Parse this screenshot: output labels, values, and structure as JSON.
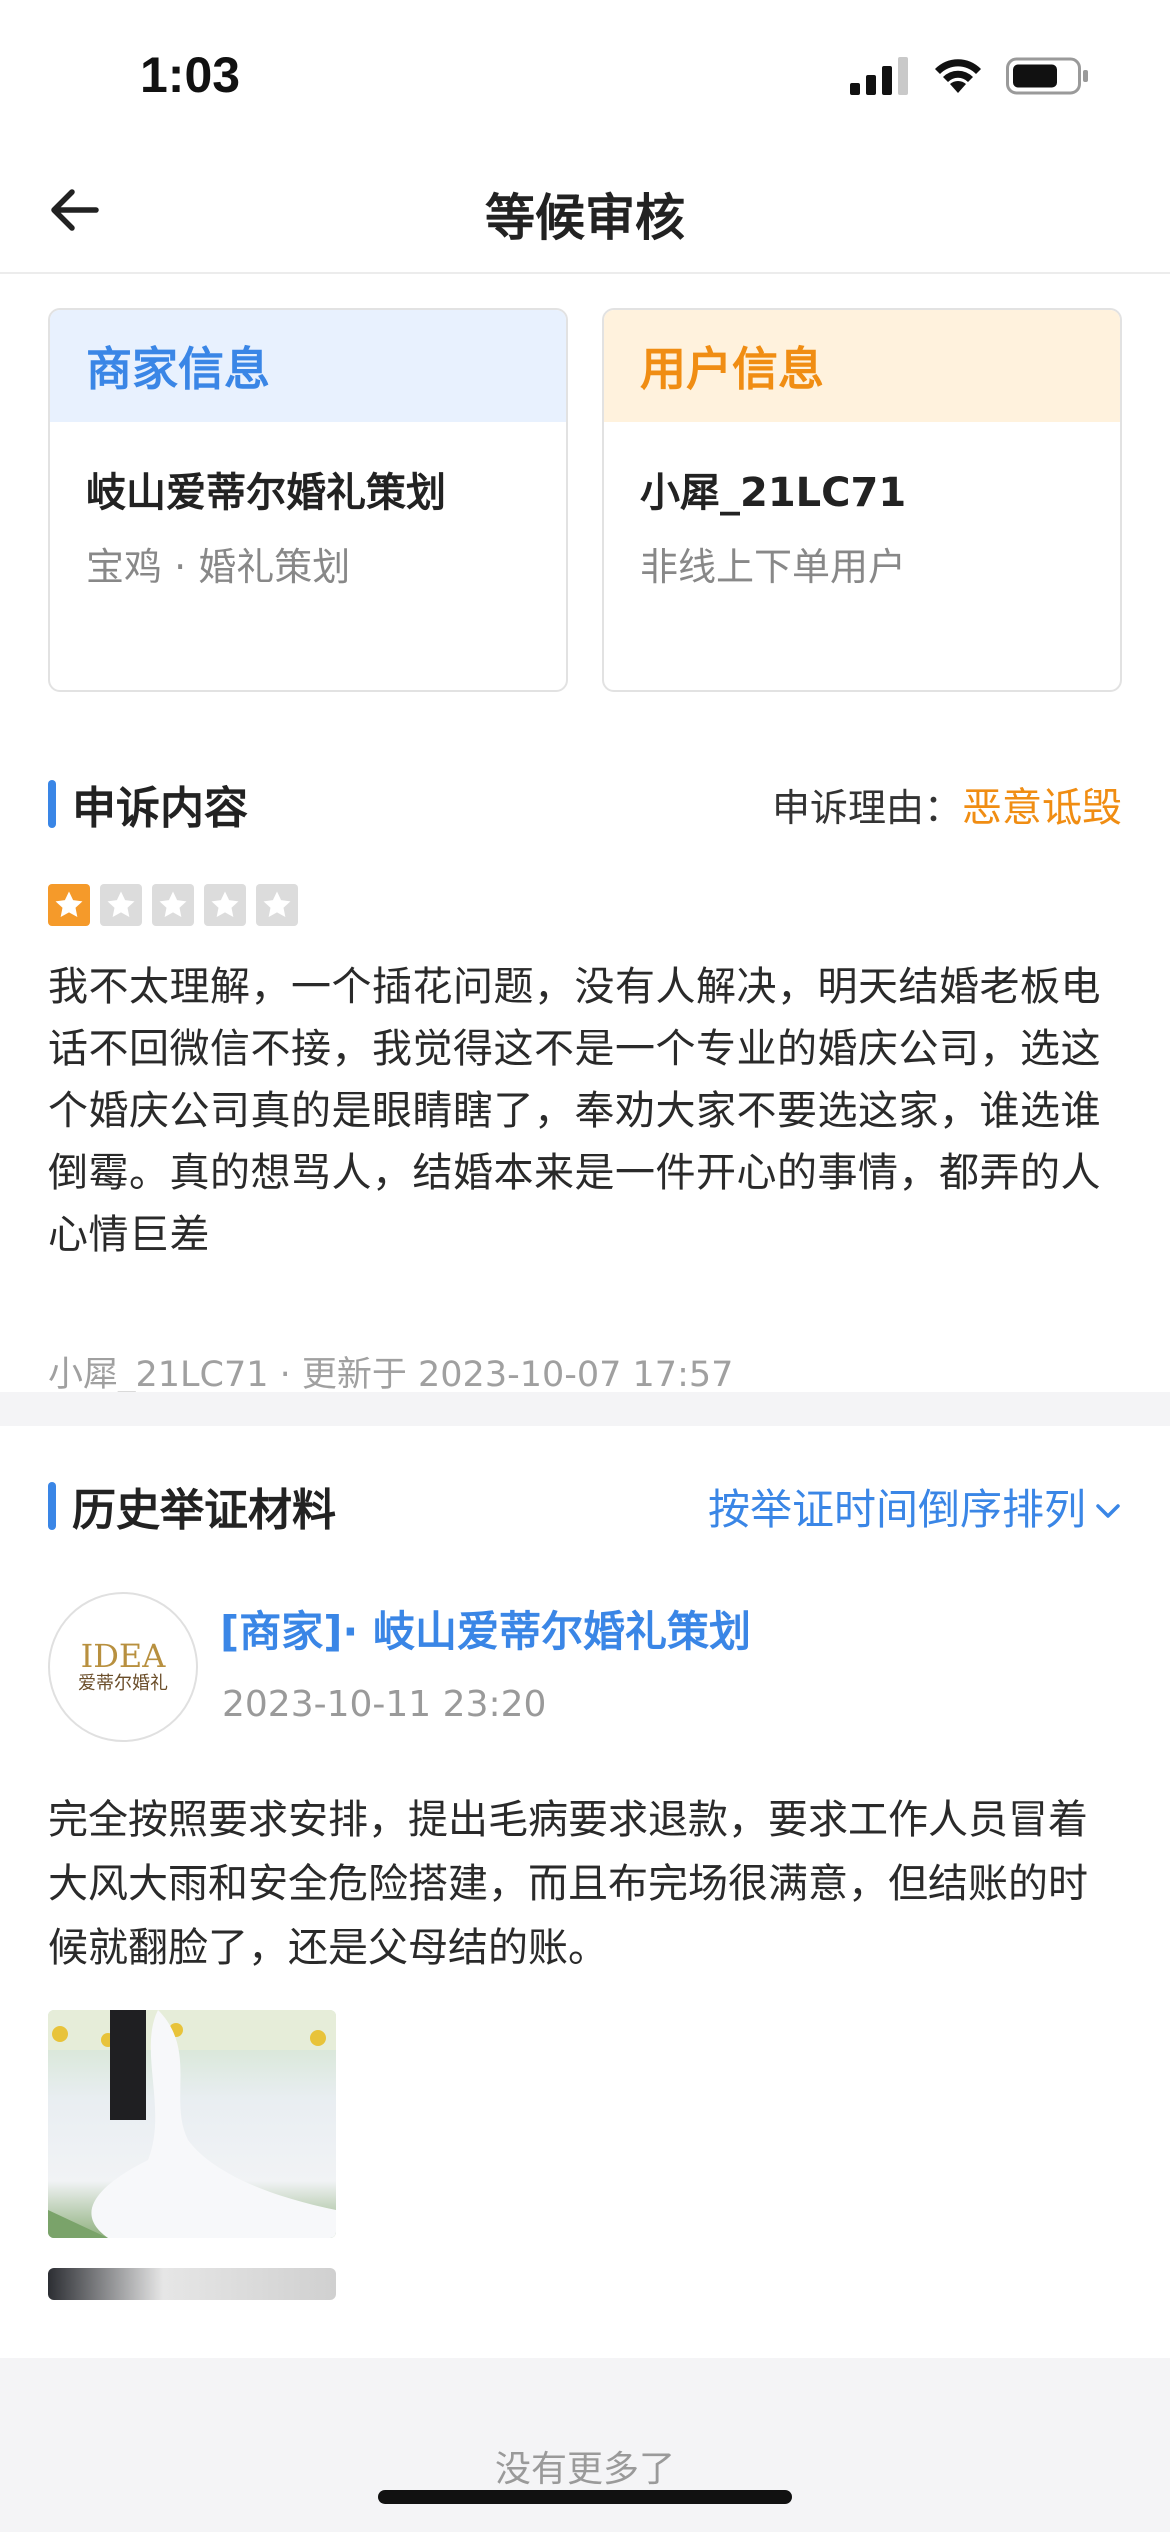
{
  "status_bar": {
    "time": "1:03"
  },
  "nav": {
    "title": "等候审核"
  },
  "merchant_card": {
    "heading": "商家信息",
    "name": "岐山爱蒂尔婚礼策划",
    "subtitle": "宝鸡 · 婚礼策划"
  },
  "user_card": {
    "heading": "用户信息",
    "name": "小犀_21LC71",
    "subtitle": "非线上下单用户"
  },
  "complaint": {
    "section_title": "申诉内容",
    "reason_label": "申诉理由：",
    "reason_value": "恶意诋毁",
    "rating": 1,
    "rating_max": 5,
    "text": "我不太理解，一个插花问题，没有人解决，明天结婚老板电话不回微信不接，我觉得这不是一个专业的婚庆公司，选这个婚庆公司真的是眼睛瞎了，奉劝大家不要选这家，谁选谁倒霉。真的想骂人，结婚本来是一件开心的事情，都弄的人心情巨差",
    "meta": "小犀_21LC71 · 更新于 2023-10-07 17:57"
  },
  "evidence": {
    "section_title": "历史举证材料",
    "sort_label": "按举证时间倒序排列",
    "entries": [
      {
        "avatar_logo": "IDEA",
        "avatar_name": "爱蒂尔婚礼",
        "author": "[商家]· 岐山爱蒂尔婚礼策划",
        "time": "2023-10-11 23:20",
        "text": "完全按照要求安排，提出毛病要求退款，要求工作人员冒着大风大雨和安全危险搭建，而且布完场很满意，但结账的时候就翻脸了，还是父母结的账。"
      }
    ]
  },
  "footer": {
    "no_more": "没有更多了"
  },
  "colors": {
    "accent_blue": "#3a86e6",
    "accent_orange": "#f08d13",
    "star_on": "#f59a2a",
    "star_off": "#dcdcdc"
  }
}
